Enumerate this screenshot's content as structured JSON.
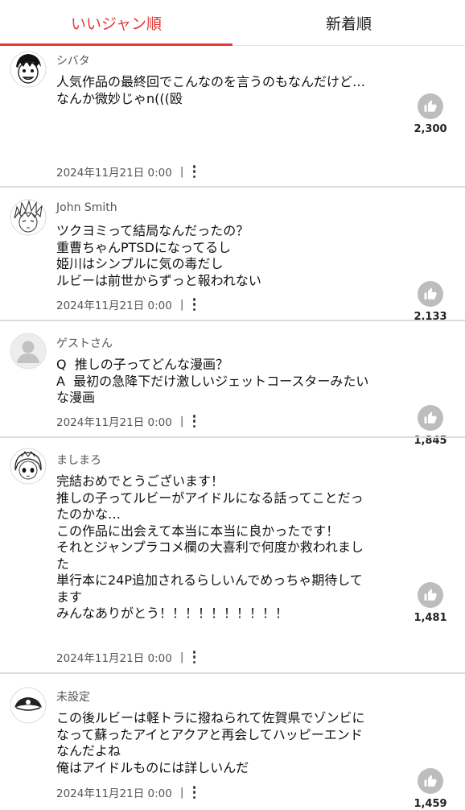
{
  "tabs": [
    {
      "label": "いいジャン順",
      "active": true
    },
    {
      "label": "新着順",
      "active": false
    }
  ],
  "colors": {
    "accent": "#e53935",
    "like_button": "#bdbdbd"
  },
  "comments": [
    {
      "username": "シバタ",
      "avatar": "manga-face-avatar",
      "lines": [
        "人気作品の最終回でこんなのを言うのもなんだけど…",
        "",
        "",
        "",
        "なんか微妙じゃn(((殴"
      ],
      "date": "2024年11月21日 0:00",
      "likes": "2,300"
    },
    {
      "username": "John Smith",
      "avatar": "manga-spiky-hair-avatar",
      "lines": [
        "ツクヨミって結局なんだったの？",
        "重曹ちゃんPTSDになってるし",
        "姫川はシンプルに気の毒だし",
        "ルビーは前世からずっと報われない"
      ],
      "date": "2024年11月21日 0:00",
      "likes": "2,133"
    },
    {
      "username": "ゲストさん",
      "avatar": "guest-default-avatar",
      "lines": [
        "Q  推しの子ってどんな漫画？",
        "A  最初の急降下だけ激しいジェットコースターみたい",
        "な漫画"
      ],
      "date": "2024年11月21日 0:00",
      "likes": "1,845"
    },
    {
      "username": "ましまろ",
      "avatar": "manga-girl-avatar",
      "lines": [
        "完結おめでとうございます！",
        "",
        "推しの子ってルビーがアイドルになる話ってことだっ",
        "たのかな…",
        "この作品に出会えて本当に本当に良かったです！",
        "それとジャンプラコメ欄の大喜利で何度か救われまし",
        "た",
        "単行本に24P追加されるらしいんでめっちゃ期待して",
        "ます",
        "みんなありがとう！！！！！！！！！！"
      ],
      "date": "2024年11月21日 0:00",
      "likes": "1,481"
    },
    {
      "username": "未設定",
      "avatar": "pirate-hat-avatar",
      "lines": [
        "この後ルビーは軽トラに撥ねられて佐賀県でゾンビに",
        "なって蘇ったアイとアクアと再会してハッピーエンド",
        "なんだよね",
        "俺はアイドルものには詳しいんだ"
      ],
      "date": "2024年11月21日 0:00",
      "likes": "1,459"
    }
  ]
}
